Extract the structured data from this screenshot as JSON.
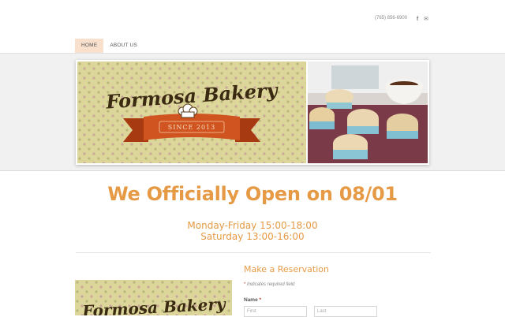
{
  "header": {
    "phone": "(765) 856-6900",
    "social": [
      {
        "icon": "facebook-icon",
        "glyph": "f"
      },
      {
        "icon": "email-icon",
        "glyph": "✉"
      }
    ]
  },
  "nav": {
    "items": [
      {
        "label": "HOME",
        "active": true
      },
      {
        "label": "ABOUT US",
        "active": false
      }
    ]
  },
  "banner": {
    "logo_text": "Formosa Bakery",
    "ribbon_text": "SINCE 2013"
  },
  "main": {
    "headline": "We Officially Open on 08/01",
    "hours_line1": "Monday-Friday 15:00-18:00",
    "hours_line2": "Saturday 13:00-16:00"
  },
  "reservation": {
    "title": "Make a Reservation",
    "required_note": "Indicates required field",
    "required_mark": "*",
    "name_label": "Name",
    "first_placeholder": "First",
    "last_placeholder": "Last"
  },
  "thumbnail": {
    "logo_text": "Formosa Bakery"
  },
  "colors": {
    "accent": "#e69a45",
    "nav_active_bg": "#f8e0cc",
    "logo_bg": "#dcd595",
    "ribbon": "#d0541f",
    "logo_text": "#3a2a12"
  }
}
